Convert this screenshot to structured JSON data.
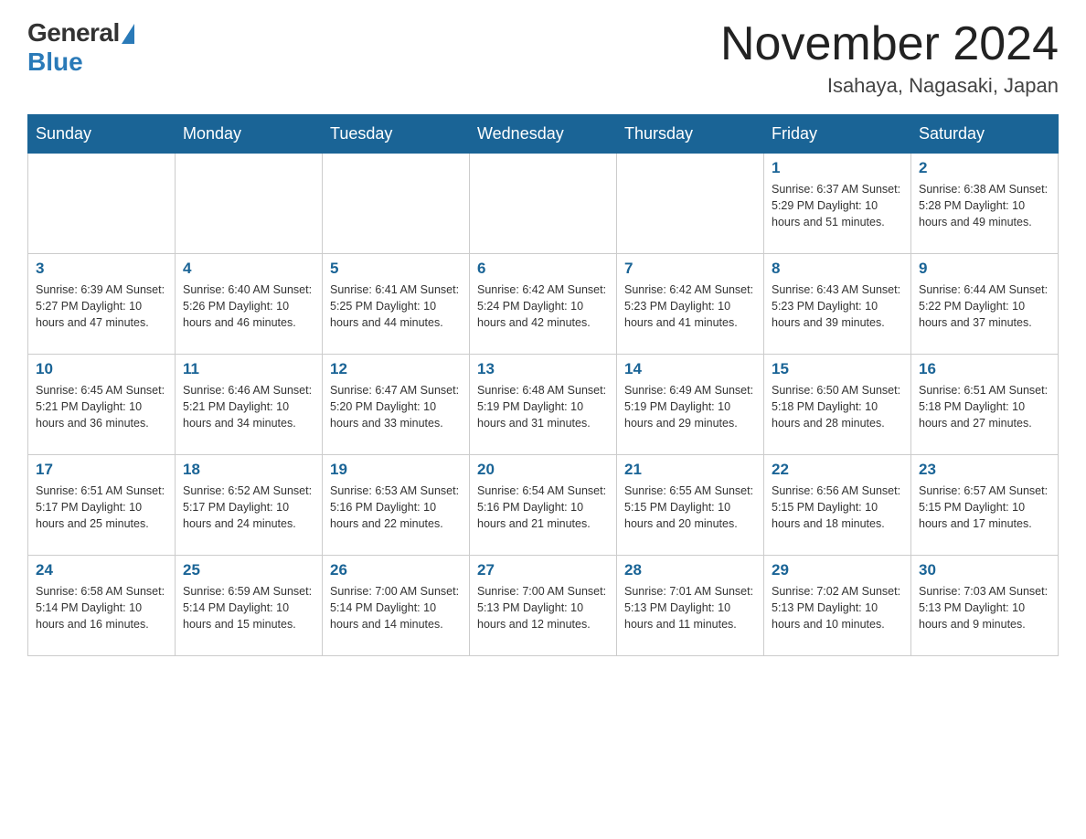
{
  "header": {
    "logo_general": "General",
    "logo_blue": "Blue",
    "month_year": "November 2024",
    "location": "Isahaya, Nagasaki, Japan"
  },
  "weekdays": [
    "Sunday",
    "Monday",
    "Tuesday",
    "Wednesday",
    "Thursday",
    "Friday",
    "Saturday"
  ],
  "weeks": [
    [
      {
        "day": "",
        "info": ""
      },
      {
        "day": "",
        "info": ""
      },
      {
        "day": "",
        "info": ""
      },
      {
        "day": "",
        "info": ""
      },
      {
        "day": "",
        "info": ""
      },
      {
        "day": "1",
        "info": "Sunrise: 6:37 AM\nSunset: 5:29 PM\nDaylight: 10 hours and 51 minutes."
      },
      {
        "day": "2",
        "info": "Sunrise: 6:38 AM\nSunset: 5:28 PM\nDaylight: 10 hours and 49 minutes."
      }
    ],
    [
      {
        "day": "3",
        "info": "Sunrise: 6:39 AM\nSunset: 5:27 PM\nDaylight: 10 hours and 47 minutes."
      },
      {
        "day": "4",
        "info": "Sunrise: 6:40 AM\nSunset: 5:26 PM\nDaylight: 10 hours and 46 minutes."
      },
      {
        "day": "5",
        "info": "Sunrise: 6:41 AM\nSunset: 5:25 PM\nDaylight: 10 hours and 44 minutes."
      },
      {
        "day": "6",
        "info": "Sunrise: 6:42 AM\nSunset: 5:24 PM\nDaylight: 10 hours and 42 minutes."
      },
      {
        "day": "7",
        "info": "Sunrise: 6:42 AM\nSunset: 5:23 PM\nDaylight: 10 hours and 41 minutes."
      },
      {
        "day": "8",
        "info": "Sunrise: 6:43 AM\nSunset: 5:23 PM\nDaylight: 10 hours and 39 minutes."
      },
      {
        "day": "9",
        "info": "Sunrise: 6:44 AM\nSunset: 5:22 PM\nDaylight: 10 hours and 37 minutes."
      }
    ],
    [
      {
        "day": "10",
        "info": "Sunrise: 6:45 AM\nSunset: 5:21 PM\nDaylight: 10 hours and 36 minutes."
      },
      {
        "day": "11",
        "info": "Sunrise: 6:46 AM\nSunset: 5:21 PM\nDaylight: 10 hours and 34 minutes."
      },
      {
        "day": "12",
        "info": "Sunrise: 6:47 AM\nSunset: 5:20 PM\nDaylight: 10 hours and 33 minutes."
      },
      {
        "day": "13",
        "info": "Sunrise: 6:48 AM\nSunset: 5:19 PM\nDaylight: 10 hours and 31 minutes."
      },
      {
        "day": "14",
        "info": "Sunrise: 6:49 AM\nSunset: 5:19 PM\nDaylight: 10 hours and 29 minutes."
      },
      {
        "day": "15",
        "info": "Sunrise: 6:50 AM\nSunset: 5:18 PM\nDaylight: 10 hours and 28 minutes."
      },
      {
        "day": "16",
        "info": "Sunrise: 6:51 AM\nSunset: 5:18 PM\nDaylight: 10 hours and 27 minutes."
      }
    ],
    [
      {
        "day": "17",
        "info": "Sunrise: 6:51 AM\nSunset: 5:17 PM\nDaylight: 10 hours and 25 minutes."
      },
      {
        "day": "18",
        "info": "Sunrise: 6:52 AM\nSunset: 5:17 PM\nDaylight: 10 hours and 24 minutes."
      },
      {
        "day": "19",
        "info": "Sunrise: 6:53 AM\nSunset: 5:16 PM\nDaylight: 10 hours and 22 minutes."
      },
      {
        "day": "20",
        "info": "Sunrise: 6:54 AM\nSunset: 5:16 PM\nDaylight: 10 hours and 21 minutes."
      },
      {
        "day": "21",
        "info": "Sunrise: 6:55 AM\nSunset: 5:15 PM\nDaylight: 10 hours and 20 minutes."
      },
      {
        "day": "22",
        "info": "Sunrise: 6:56 AM\nSunset: 5:15 PM\nDaylight: 10 hours and 18 minutes."
      },
      {
        "day": "23",
        "info": "Sunrise: 6:57 AM\nSunset: 5:15 PM\nDaylight: 10 hours and 17 minutes."
      }
    ],
    [
      {
        "day": "24",
        "info": "Sunrise: 6:58 AM\nSunset: 5:14 PM\nDaylight: 10 hours and 16 minutes."
      },
      {
        "day": "25",
        "info": "Sunrise: 6:59 AM\nSunset: 5:14 PM\nDaylight: 10 hours and 15 minutes."
      },
      {
        "day": "26",
        "info": "Sunrise: 7:00 AM\nSunset: 5:14 PM\nDaylight: 10 hours and 14 minutes."
      },
      {
        "day": "27",
        "info": "Sunrise: 7:00 AM\nSunset: 5:13 PM\nDaylight: 10 hours and 12 minutes."
      },
      {
        "day": "28",
        "info": "Sunrise: 7:01 AM\nSunset: 5:13 PM\nDaylight: 10 hours and 11 minutes."
      },
      {
        "day": "29",
        "info": "Sunrise: 7:02 AM\nSunset: 5:13 PM\nDaylight: 10 hours and 10 minutes."
      },
      {
        "day": "30",
        "info": "Sunrise: 7:03 AM\nSunset: 5:13 PM\nDaylight: 10 hours and 9 minutes."
      }
    ]
  ]
}
